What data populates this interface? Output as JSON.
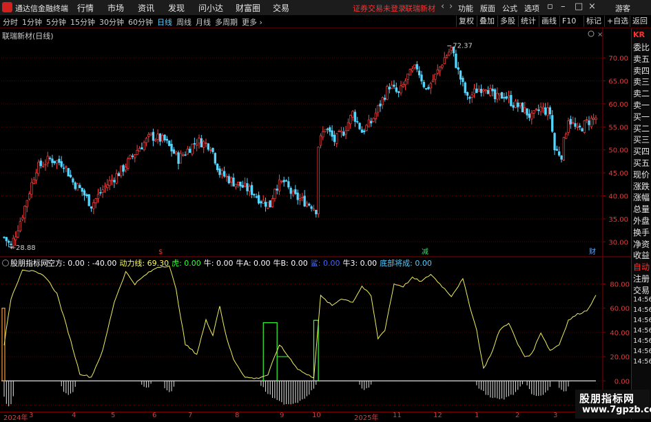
{
  "app": {
    "name": "通达信金融终端",
    "menus": [
      "行情",
      "市场",
      "资讯",
      "发现",
      "问小达",
      "财富圈",
      "交易"
    ],
    "notice": "证券交易未登录",
    "stock_name_header": "联瑞新材",
    "right_menus": [
      "功能",
      "版面",
      "公式",
      "选项"
    ],
    "user": "游客"
  },
  "periods": [
    "分时",
    "1分钟",
    "5分钟",
    "15分钟",
    "30分钟",
    "60分钟",
    "日线",
    "周线",
    "月线",
    "多周期",
    "更多"
  ],
  "active_period": "日线",
  "toolbar_right": [
    "复权",
    "叠加",
    "多股",
    "统计",
    "画线",
    "F10",
    "标记",
    "+自选",
    "返回"
  ],
  "chart_title": "联瑞新材(日线)",
  "price_axis": [
    "70.00",
    "65.00",
    "60.00",
    "55.00",
    "50.00",
    "45.00",
    "40.00",
    "35.00",
    "30.00"
  ],
  "price_markers": {
    "high": "72.37",
    "low": "28.88"
  },
  "event_markers": [
    "$",
    "减",
    "财"
  ],
  "indicator": {
    "name": "股朋指标网",
    "fields": [
      {
        "label": "空方:",
        "value": "0.00",
        "color": "#ffffff"
      },
      {
        "label": ":",
        "value": "-40.00",
        "color": "#ffffff"
      },
      {
        "label": "动力线:",
        "value": "69.30",
        "color": "#ffff55"
      },
      {
        "label": "虎:",
        "value": "0.00",
        "color": "#33ff33"
      },
      {
        "label": "牛:",
        "value": "0.00",
        "color": "#ffffff"
      },
      {
        "label": "牛A:",
        "value": "0.00",
        "color": "#ffffff"
      },
      {
        "label": "牛B:",
        "value": "0.00",
        "color": "#ffffff"
      },
      {
        "label": "鲨:",
        "value": "0.00",
        "color": "#4466ff"
      },
      {
        "label": "牛3:",
        "value": "0.00",
        "color": "#ffffff"
      },
      {
        "label": "底部将成:",
        "value": "0.00",
        "color": "#55ccff"
      }
    ],
    "axis": [
      "80.00",
      "60.00",
      "40.00",
      "20.00",
      "0.00",
      "-20.00"
    ]
  },
  "dates": [
    "2024年",
    "3",
    "4",
    "5",
    "6",
    "7",
    "8",
    "9",
    "10",
    "2025年",
    "11",
    "12",
    "1",
    "2",
    "3",
    "4",
    "5"
  ],
  "side_labels": [
    "KR",
    "委比",
    "卖五",
    "卖四",
    "卖三",
    "卖二",
    "卖一",
    "买一",
    "买二",
    "买三",
    "买四",
    "买五",
    "现价",
    "涨跌",
    "涨幅",
    "总量",
    "外盘",
    "换手",
    "净资",
    "收益",
    "自动",
    "注册",
    "交易",
    "14:56",
    "14:56",
    "14:56",
    "14:56",
    "14:56",
    "14:56",
    "14:56"
  ],
  "watermark": {
    "line1": "股朋指标网",
    "line2": "www.7gpzb.com"
  },
  "chart_data": {
    "type": "candlestick",
    "title": "联瑞新材(日线)",
    "ylim": [
      27.5,
      74.5
    ],
    "price_knots": [
      [
        0,
        31
      ],
      [
        3,
        29
      ],
      [
        8,
        36
      ],
      [
        14,
        46
      ],
      [
        20,
        48
      ],
      [
        26,
        47
      ],
      [
        30,
        43
      ],
      [
        34,
        41
      ],
      [
        38,
        38
      ],
      [
        44,
        42
      ],
      [
        48,
        44
      ],
      [
        52,
        46
      ],
      [
        58,
        50
      ],
      [
        64,
        53
      ],
      [
        70,
        52
      ],
      [
        76,
        48
      ],
      [
        80,
        50
      ],
      [
        84,
        52
      ],
      [
        90,
        51
      ],
      [
        94,
        45
      ],
      [
        100,
        43
      ],
      [
        104,
        42
      ],
      [
        108,
        41
      ],
      [
        112,
        39
      ],
      [
        116,
        38
      ],
      [
        118,
        42
      ],
      [
        122,
        43
      ],
      [
        126,
        40
      ],
      [
        130,
        39
      ],
      [
        134,
        38
      ],
      [
        136,
        37
      ],
      [
        137,
        51
      ],
      [
        140,
        55
      ],
      [
        144,
        52
      ],
      [
        148,
        54
      ],
      [
        152,
        58
      ],
      [
        156,
        54
      ],
      [
        160,
        56
      ],
      [
        164,
        60
      ],
      [
        168,
        64
      ],
      [
        172,
        62
      ],
      [
        176,
        66
      ],
      [
        180,
        68
      ],
      [
        184,
        63
      ],
      [
        188,
        66
      ],
      [
        192,
        70
      ],
      [
        195,
        72
      ],
      [
        198,
        67
      ],
      [
        202,
        61
      ],
      [
        206,
        63
      ],
      [
        210,
        64
      ],
      [
        214,
        61
      ],
      [
        218,
        62
      ],
      [
        222,
        60
      ],
      [
        226,
        59
      ],
      [
        230,
        57
      ],
      [
        234,
        59
      ],
      [
        238,
        58
      ],
      [
        240,
        50
      ],
      [
        243,
        49
      ],
      [
        246,
        57
      ],
      [
        250,
        54
      ],
      [
        254,
        56
      ],
      [
        258,
        57
      ]
    ],
    "high": 72.37,
    "low": 28.88,
    "indicator_series": {
      "name": "动力线",
      "knots": [
        [
          0,
          30
        ],
        [
          3,
          68
        ],
        [
          8,
          92
        ],
        [
          13,
          90
        ],
        [
          18,
          86
        ],
        [
          23,
          72
        ],
        [
          28,
          40
        ],
        [
          33,
          6
        ],
        [
          38,
          3
        ],
        [
          43,
          25
        ],
        [
          48,
          65
        ],
        [
          53,
          90
        ],
        [
          57,
          80
        ],
        [
          62,
          88
        ],
        [
          67,
          94
        ],
        [
          72,
          95
        ],
        [
          75,
          75
        ],
        [
          79,
          30
        ],
        [
          84,
          22
        ],
        [
          88,
          50
        ],
        [
          91,
          38
        ],
        [
          94,
          62
        ],
        [
          97,
          35
        ],
        [
          100,
          18
        ],
        [
          105,
          3
        ],
        [
          110,
          2
        ],
        [
          115,
          5
        ],
        [
          120,
          30
        ],
        [
          124,
          20
        ],
        [
          128,
          10
        ],
        [
          132,
          5
        ],
        [
          135,
          3
        ],
        [
          138,
          70
        ],
        [
          143,
          62
        ],
        [
          147,
          68
        ],
        [
          152,
          65
        ],
        [
          156,
          78
        ],
        [
          160,
          70
        ],
        [
          163,
          35
        ],
        [
          166,
          42
        ],
        [
          170,
          80
        ],
        [
          174,
          78
        ],
        [
          178,
          85
        ],
        [
          182,
          82
        ],
        [
          186,
          88
        ],
        [
          190,
          80
        ],
        [
          195,
          70
        ],
        [
          200,
          84
        ],
        [
          203,
          62
        ],
        [
          206,
          42
        ],
        [
          209,
          10
        ],
        [
          213,
          25
        ],
        [
          216,
          42
        ],
        [
          220,
          48
        ],
        [
          224,
          30
        ],
        [
          227,
          20
        ],
        [
          230,
          22
        ],
        [
          234,
          40
        ],
        [
          238,
          25
        ],
        [
          242,
          30
        ],
        [
          246,
          50
        ],
        [
          250,
          55
        ],
        [
          254,
          58
        ],
        [
          258,
          70
        ]
      ],
      "ylim": [
        -22,
        95
      ]
    }
  }
}
